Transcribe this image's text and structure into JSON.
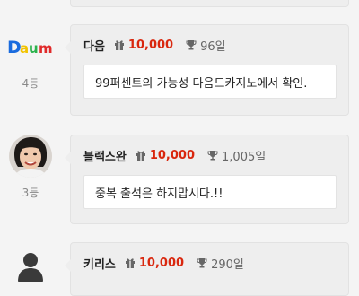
{
  "entries": [
    {
      "rank": "4등",
      "name": "다음",
      "points": "10,000",
      "days": "96일",
      "message": "99퍼센트의 가능성 다음드카지노에서 확인.",
      "logo_text": "Daum",
      "logo_colors": [
        "#1a6bde",
        "#f2c300",
        "#2bb24c",
        "#e02a2a"
      ]
    },
    {
      "rank": "3등",
      "name": "블랙스완",
      "points": "10,000",
      "days": "1,005일",
      "message": "중복 출석은 하지맙시다.!!"
    },
    {
      "name": "키리스",
      "points": "10,000",
      "days": "290일"
    }
  ],
  "colors": {
    "points": "#d9270e",
    "card_bg": "#eeeeee",
    "page_bg": "#f4f4f4"
  },
  "icons": {
    "gift": "gift-icon",
    "trophy": "trophy-icon",
    "default_avatar": "user-silhouette-icon"
  }
}
